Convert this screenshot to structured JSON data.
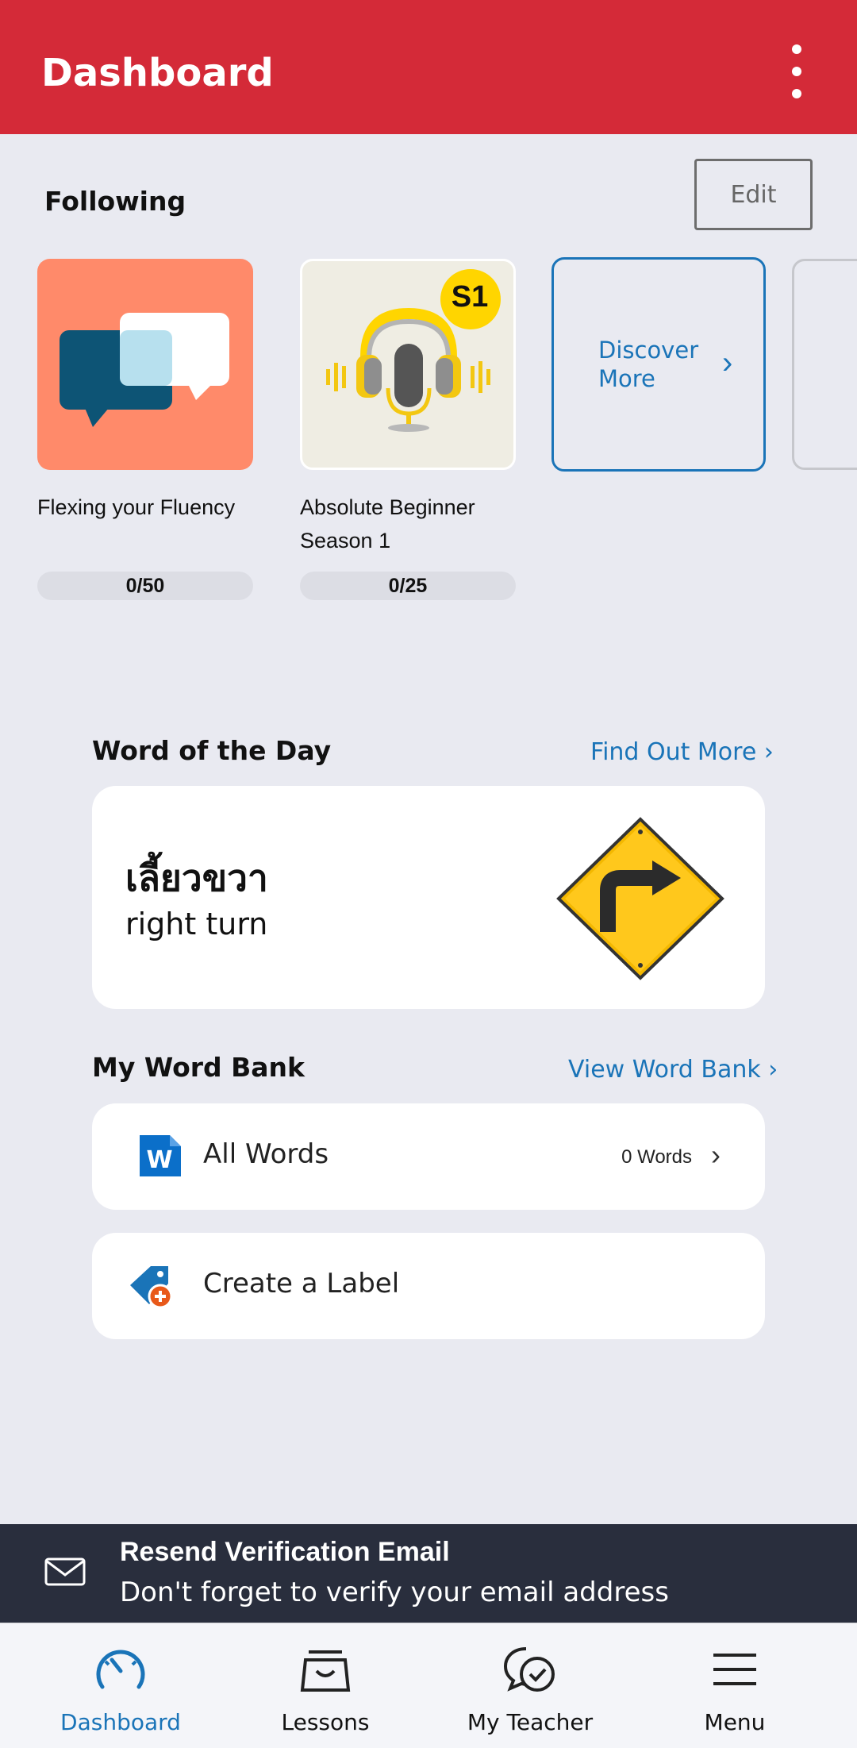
{
  "appbar": {
    "title": "Dashboard",
    "menu_icon": "more-vertical-icon"
  },
  "following": {
    "title": "Following",
    "edit_label": "Edit",
    "courses": [
      {
        "name": "Flexing your Fluency",
        "progress": "0/50",
        "thumb_color": "#ff8a6a"
      },
      {
        "name": "Absolute Beginner Season 1",
        "progress": "0/25",
        "badge": "S1",
        "thumb_color": "#efede3"
      }
    ],
    "discover_label": "Discover More"
  },
  "word_of_day": {
    "title": "Word of the Day",
    "link": "Find Out More",
    "thai": "เลี้ยวขวา",
    "english": "right turn"
  },
  "word_bank": {
    "title": "My Word Bank",
    "link": "View Word Bank",
    "all_words_label": "All Words",
    "all_words_count": "0 Words",
    "create_label": "Create a Label"
  },
  "banner": {
    "title": "Resend Verification Email",
    "subtitle": "Don't forget to verify your email address"
  },
  "nav": {
    "items": [
      {
        "label": "Dashboard",
        "icon": "dashboard-gauge-icon",
        "active": true
      },
      {
        "label": "Lessons",
        "icon": "lessons-tray-icon"
      },
      {
        "label": "My Teacher",
        "icon": "teacher-chat-icon"
      },
      {
        "label": "Menu",
        "icon": "hamburger-menu-icon"
      }
    ]
  },
  "colors": {
    "brand_red": "#d42a38",
    "accent_blue": "#1a74b8",
    "banner_dark": "#292e3d"
  }
}
